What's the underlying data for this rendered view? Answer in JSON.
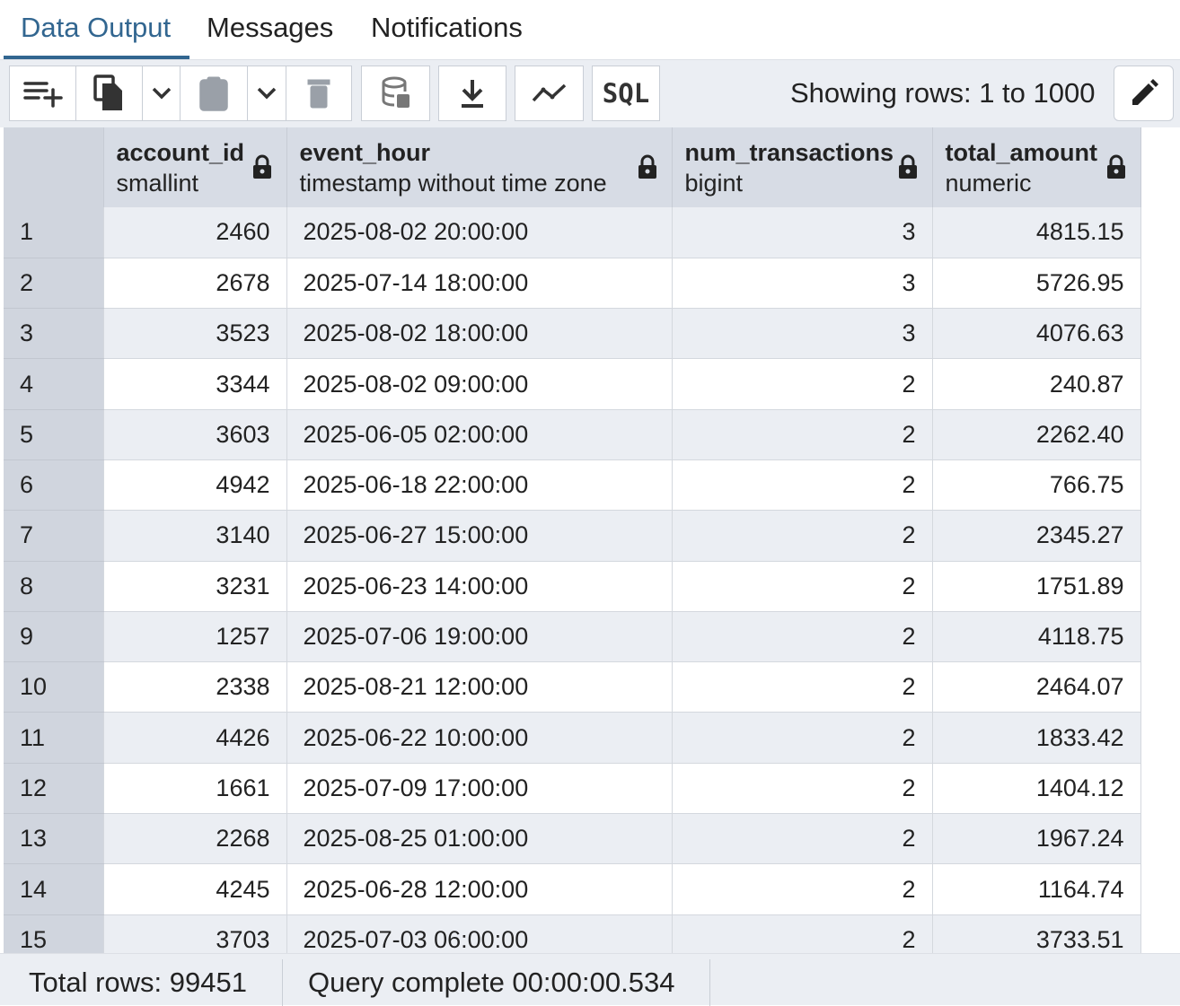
{
  "tabs": [
    {
      "label": "Data Output",
      "active": true
    },
    {
      "label": "Messages",
      "active": false
    },
    {
      "label": "Notifications",
      "active": false
    }
  ],
  "toolbar": {
    "buttons": [
      {
        "icon": "add-row-icon"
      },
      {
        "icon": "copy-icon"
      },
      {
        "icon": "chevron-down-icon"
      },
      {
        "icon": "paste-icon"
      },
      {
        "icon": "chevron-down-icon"
      },
      {
        "icon": "delete-icon"
      },
      {
        "icon": "save-data-icon"
      },
      {
        "icon": "download-icon"
      },
      {
        "icon": "graph-icon"
      },
      {
        "icon": "sql-icon",
        "label": "SQL"
      },
      {
        "icon": "edit-icon"
      }
    ],
    "rows_label": "Showing rows: 1 to 1000"
  },
  "grid": {
    "columns": [
      {
        "name": "account_id",
        "type": "smallint"
      },
      {
        "name": "event_hour",
        "type": "timestamp without time zone"
      },
      {
        "name": "num_transactions",
        "type": "bigint"
      },
      {
        "name": "total_amount",
        "type": "numeric"
      }
    ],
    "rows": [
      {
        "n": "1",
        "account_id": "2460",
        "event_hour": "2025-08-02 20:00:00",
        "num_transactions": "3",
        "total_amount": "4815.15"
      },
      {
        "n": "2",
        "account_id": "2678",
        "event_hour": "2025-07-14 18:00:00",
        "num_transactions": "3",
        "total_amount": "5726.95"
      },
      {
        "n": "3",
        "account_id": "3523",
        "event_hour": "2025-08-02 18:00:00",
        "num_transactions": "3",
        "total_amount": "4076.63"
      },
      {
        "n": "4",
        "account_id": "3344",
        "event_hour": "2025-08-02 09:00:00",
        "num_transactions": "2",
        "total_amount": "240.87"
      },
      {
        "n": "5",
        "account_id": "3603",
        "event_hour": "2025-06-05 02:00:00",
        "num_transactions": "2",
        "total_amount": "2262.40"
      },
      {
        "n": "6",
        "account_id": "4942",
        "event_hour": "2025-06-18 22:00:00",
        "num_transactions": "2",
        "total_amount": "766.75"
      },
      {
        "n": "7",
        "account_id": "3140",
        "event_hour": "2025-06-27 15:00:00",
        "num_transactions": "2",
        "total_amount": "2345.27"
      },
      {
        "n": "8",
        "account_id": "3231",
        "event_hour": "2025-06-23 14:00:00",
        "num_transactions": "2",
        "total_amount": "1751.89"
      },
      {
        "n": "9",
        "account_id": "1257",
        "event_hour": "2025-07-06 19:00:00",
        "num_transactions": "2",
        "total_amount": "4118.75"
      },
      {
        "n": "10",
        "account_id": "2338",
        "event_hour": "2025-08-21 12:00:00",
        "num_transactions": "2",
        "total_amount": "2464.07"
      },
      {
        "n": "11",
        "account_id": "4426",
        "event_hour": "2025-06-22 10:00:00",
        "num_transactions": "2",
        "total_amount": "1833.42"
      },
      {
        "n": "12",
        "account_id": "1661",
        "event_hour": "2025-07-09 17:00:00",
        "num_transactions": "2",
        "total_amount": "1404.12"
      },
      {
        "n": "13",
        "account_id": "2268",
        "event_hour": "2025-08-25 01:00:00",
        "num_transactions": "2",
        "total_amount": "1967.24"
      },
      {
        "n": "14",
        "account_id": "4245",
        "event_hour": "2025-06-28 12:00:00",
        "num_transactions": "2",
        "total_amount": "1164.74"
      },
      {
        "n": "15",
        "account_id": "3703",
        "event_hour": "2025-07-03 06:00:00",
        "num_transactions": "2",
        "total_amount": "3733.51"
      }
    ]
  },
  "status": {
    "total_rows": "Total rows: 99451",
    "query_complete": "Query complete 00:00:00.534"
  },
  "colors": {
    "accent": "#326690",
    "toolbar_bg": "#ebeef3",
    "header_bg": "#d7dce5",
    "row_number_bg": "#d0d5de"
  }
}
